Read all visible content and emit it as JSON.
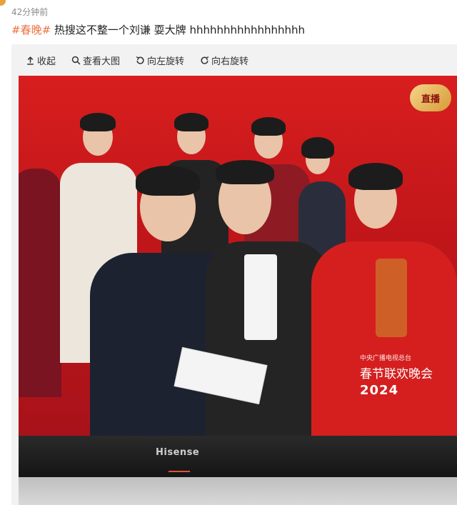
{
  "post": {
    "timestamp": "42分钟前",
    "hashtag": "#春晚#",
    "text": " 热搜这不整一个刘谦 耍大牌 hhhhhhhhhhhhhhhhh"
  },
  "toolbar": {
    "items": [
      {
        "label": "收起",
        "icon": "collapse-icon"
      },
      {
        "label": "查看大图",
        "icon": "search-icon"
      },
      {
        "label": "向左旋转",
        "icon": "rotate-left-icon"
      },
      {
        "label": "向右旋转",
        "icon": "rotate-right-icon"
      }
    ]
  },
  "photo": {
    "live_badge": "直播",
    "caption_org": "中央广播电视总台",
    "caption_title": "春节联欢晚会",
    "caption_year": "2024",
    "tv_brand": "Hisense"
  },
  "colors": {
    "hashtag": "#eb7340",
    "stage_red": "#d81e1e",
    "toolbar_bg": "#f2f2f2"
  }
}
